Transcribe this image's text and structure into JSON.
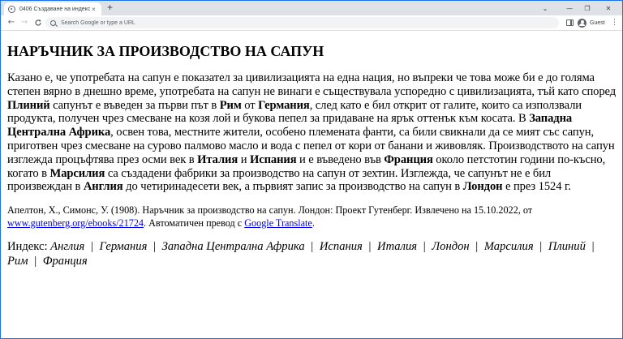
{
  "browser": {
    "tab_title": "0406 Създаване на индекс.html",
    "tab_close": "×",
    "new_tab": "+",
    "win_chevron": "⌄",
    "win_minimize": "—",
    "win_maximize": "❐",
    "win_close": "✕",
    "nav_back": "←",
    "nav_forward": "→",
    "nav_reload": "C",
    "omnibox_placeholder": "Search Google or type a URL",
    "profile_label": "Guest",
    "menu": "⋮"
  },
  "page": {
    "title": "НАРЪЧНИК ЗА ПРОИЗВОДСТВО НА САПУН",
    "body": [
      {
        "t": "Казано е, че употребата на сапун е показател за цивилизацията на една нация, но въпреки че това може би е до голяма степен вярно в днешно време, употребата на сапун не винаги е съществувала успоредно с цивилизацията, тъй като според "
      },
      {
        "t": "Плиний",
        "b": true
      },
      {
        "t": " сапунът е въведен за първи път в "
      },
      {
        "t": "Рим",
        "b": true
      },
      {
        "t": " от "
      },
      {
        "t": "Германия",
        "b": true
      },
      {
        "t": ", след като е бил открит от галите, които са използвали продукта, получен чрез смесване на козя лой и букова пепел за придаване на ярък оттенък към косата. В "
      },
      {
        "t": "Западна Централна Африка",
        "b": true
      },
      {
        "t": ", освен това, местните жители, особено племената фанти, са били свикнали да се мият със сапун, приготвен чрез смесване на сурово палмово масло и вода с пепел от кори от банани и живовляк. Производството на сапун изглежда процъфтява през осми век в "
      },
      {
        "t": "Италия",
        "b": true
      },
      {
        "t": " и "
      },
      {
        "t": "Испания",
        "b": true
      },
      {
        "t": " и е въведено във "
      },
      {
        "t": "Франция",
        "b": true
      },
      {
        "t": " около петстотин години по-късно, когато в "
      },
      {
        "t": "Марсилия",
        "b": true
      },
      {
        "t": " са създадени фабрики за производство на сапун от зехтин. Изглежда, че сапунът не е бил произвеждан в "
      },
      {
        "t": "Англия",
        "b": true
      },
      {
        "t": " до четиринадесети век, а първият запис за производство на сапун в "
      },
      {
        "t": "Лондон",
        "b": true
      },
      {
        "t": " е през 1524 г."
      }
    ],
    "citation": {
      "text1": "Апелтон, Х., Симонс, У. (1908). Наръчник за производство на сапун. Лондон: Проект Гутенберг. Извлечено на 15.10.2022, от ",
      "link1": "www.gutenberg.org/ebooks/21724",
      "text2": ". Автоматичен превод с ",
      "link2": "Google Translate",
      "text3": "."
    },
    "index": {
      "label": "Индекс:",
      "items": [
        "Англия",
        "Германия",
        "Западна Централна Африка",
        "Испания",
        "Италия",
        "Лондон",
        "Марсилия",
        "Плиний",
        "Рим",
        "Франция"
      ],
      "separator": "|"
    }
  }
}
